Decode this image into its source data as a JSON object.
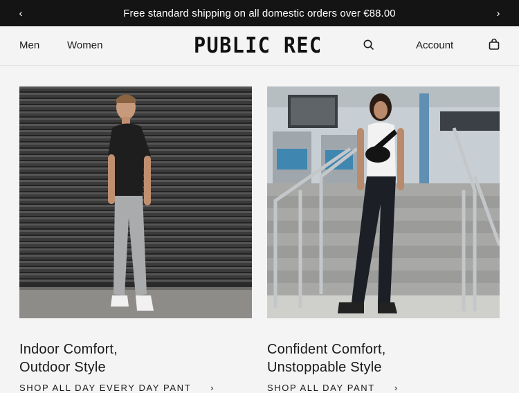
{
  "promo": {
    "message": "Free standard shipping on all domestic orders over €88.00",
    "prev_icon": "chevron-left-icon",
    "next_icon": "chevron-right-icon",
    "prev_glyph": "‹",
    "next_glyph": "›"
  },
  "header": {
    "nav": [
      "Men",
      "Women"
    ],
    "logo": "PUBLIC REC",
    "search_icon": "search-icon",
    "account_label": "Account",
    "cart_icon": "shopping-bag-icon"
  },
  "cards": [
    {
      "title": "Indoor Comfort,\nOutdoor Style",
      "link_label": "SHOP ALL DAY EVERY DAY PANT",
      "arrow": "›",
      "image": "man in black tee and grey pants against rolling shutter"
    },
    {
      "title": "Confident Comfort,\nUnstoppable Style",
      "link_label": "SHOP ALL DAY PANT",
      "arrow": "›",
      "image": "woman on concrete stairs with railings"
    }
  ],
  "colors": {
    "promo_bg": "#141414",
    "page_bg": "#f4f4f4",
    "text": "#1a1a1a"
  }
}
